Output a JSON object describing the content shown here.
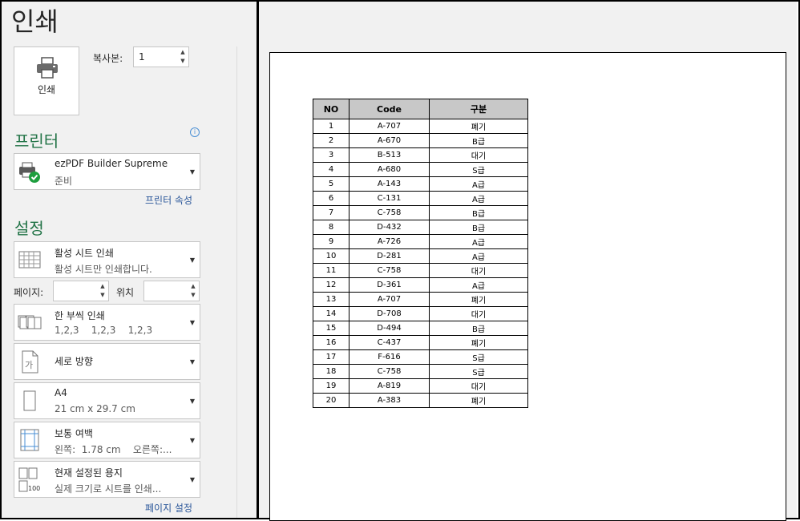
{
  "title": "인쇄",
  "print_button_label": "인쇄",
  "copies": {
    "label": "복사본:",
    "value": "1"
  },
  "printer": {
    "section_title": "프린터",
    "name": "ezPDF Builder Supreme",
    "status": "준비",
    "properties_link": "프린터 속성"
  },
  "settings": {
    "section_title": "설정",
    "what": {
      "title": "활성 시트 인쇄",
      "subtitle": "활성 시트만 인쇄합니다."
    },
    "pages_label": "페이지:",
    "to_label": "위치",
    "collate": {
      "title": "한 부씩 인쇄",
      "subtitle": "1,2,3    1,2,3    1,2,3"
    },
    "orientation": {
      "title": "세로 방향"
    },
    "paper": {
      "title": "A4",
      "subtitle": "21 cm x 29.7 cm"
    },
    "margins": {
      "title": "보통 여백",
      "subtitle": "왼쪽:  1.78 cm    오른쪽:..."
    },
    "scaling": {
      "title": "현재 설정된 용지",
      "subtitle": "실제 크기로 시트를 인쇄..."
    },
    "page_setup_link": "페이지 설정"
  },
  "preview": {
    "headers": [
      "NO",
      "Code",
      "구분"
    ],
    "rows": [
      [
        "1",
        "A-707",
        "폐기"
      ],
      [
        "2",
        "A-670",
        "B급"
      ],
      [
        "3",
        "B-513",
        "대기"
      ],
      [
        "4",
        "A-680",
        "S급"
      ],
      [
        "5",
        "A-143",
        "A급"
      ],
      [
        "6",
        "C-131",
        "A급"
      ],
      [
        "7",
        "C-758",
        "B급"
      ],
      [
        "8",
        "D-432",
        "B급"
      ],
      [
        "9",
        "A-726",
        "A급"
      ],
      [
        "10",
        "D-281",
        "A급"
      ],
      [
        "11",
        "C-758",
        "대기"
      ],
      [
        "12",
        "D-361",
        "A급"
      ],
      [
        "13",
        "A-707",
        "폐기"
      ],
      [
        "14",
        "D-708",
        "대기"
      ],
      [
        "15",
        "D-494",
        "B급"
      ],
      [
        "16",
        "C-437",
        "폐기"
      ],
      [
        "17",
        "F-616",
        "S급"
      ],
      [
        "18",
        "C-758",
        "S급"
      ],
      [
        "19",
        "A-819",
        "대기"
      ],
      [
        "20",
        "A-383",
        "폐기"
      ]
    ]
  },
  "icons": {
    "printer": "printer-icon",
    "info": "info-icon",
    "sheet": "sheet-grid-icon",
    "collate": "collate-icon",
    "orientation": "portrait-page-icon",
    "paper": "paper-size-icon",
    "margins": "margins-icon",
    "scaling": "scaling-icon",
    "dropdown": "chevron-down-icon"
  },
  "colors": {
    "accent": "#217346",
    "link": "#2b579a",
    "header_fill": "#c8c8c8"
  }
}
